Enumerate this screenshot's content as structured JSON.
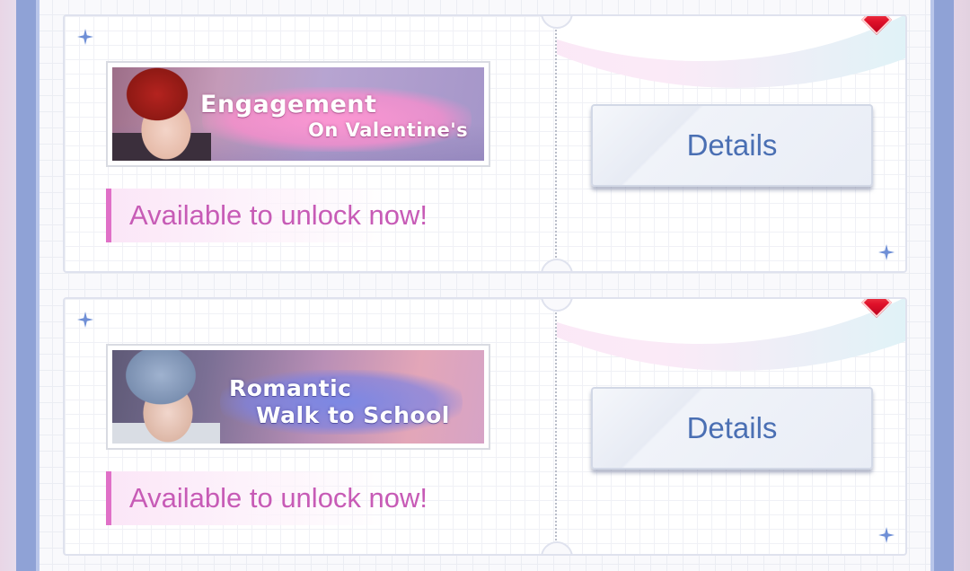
{
  "colors": {
    "frame": "#8fa2d6",
    "status_text": "#c75bb6",
    "status_accent": "#e070c7",
    "button_text": "#4a6fb3",
    "gem": "#e0112a",
    "sparkle": "#6f8fd6"
  },
  "cards": [
    {
      "banner_line1": "Engagement",
      "banner_line2": "On Valentine's",
      "status": "Available to unlock now!",
      "button_label": "Details",
      "icons": [
        "sparkle-icon",
        "red-gem-icon"
      ]
    },
    {
      "banner_line1": "Romantic",
      "banner_line2": "Walk to School",
      "status": "Available to unlock now!",
      "button_label": "Details",
      "icons": [
        "sparkle-icon",
        "red-gem-icon"
      ]
    }
  ]
}
